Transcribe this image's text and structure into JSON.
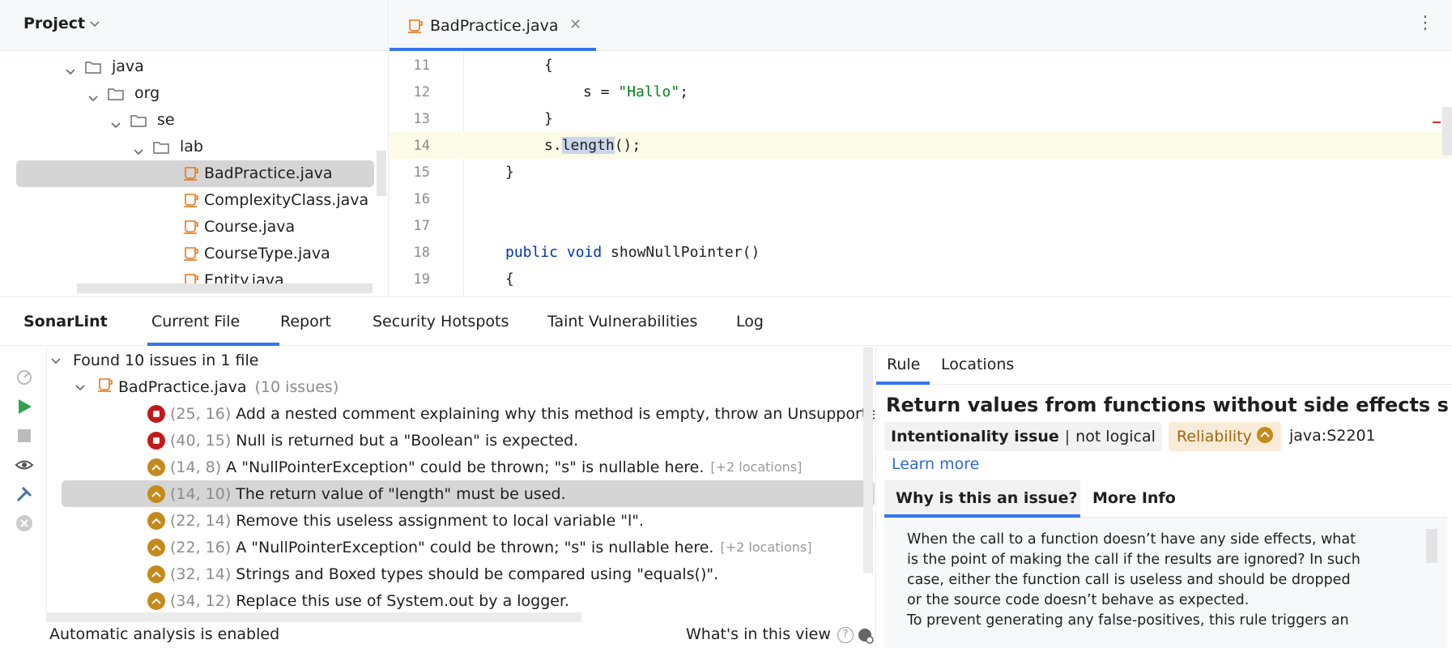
{
  "project": {
    "title": "Project"
  },
  "editor_tab": {
    "name": "BadPractice.java"
  },
  "tree": [
    {
      "label": "java",
      "type": "folder",
      "expanded": true,
      "selected": false
    },
    {
      "label": "org",
      "type": "folder",
      "expanded": true,
      "selected": false
    },
    {
      "label": "se",
      "type": "folder",
      "expanded": true,
      "selected": false
    },
    {
      "label": "lab",
      "type": "folder",
      "expanded": true,
      "selected": false
    },
    {
      "label": "BadPractice.java",
      "type": "java",
      "selected": true
    },
    {
      "label": "ComplexityClass.java",
      "type": "java",
      "selected": false
    },
    {
      "label": "Course.java",
      "type": "java",
      "selected": false
    },
    {
      "label": "CourseType.java",
      "type": "java",
      "selected": false
    },
    {
      "label": "Entity.java",
      "type": "java",
      "selected": false
    }
  ],
  "code_lines": [
    {
      "num": "11",
      "text": "{"
    },
    {
      "num": "12",
      "text": "s = ",
      "str": "\"Hallo\"",
      "after": ";"
    },
    {
      "num": "13",
      "text": "}"
    },
    {
      "num": "14",
      "text": "s.",
      "hl": "length",
      "after": "();"
    },
    {
      "num": "15",
      "text": "}"
    },
    {
      "num": "16",
      "text": ""
    },
    {
      "num": "17",
      "text": ""
    },
    {
      "num": "18",
      "kw": "public void",
      "text": " showNullPointer()"
    },
    {
      "num": "19",
      "text": "{"
    }
  ],
  "sonar": {
    "title": "SonarLint",
    "tabs": [
      "Current File",
      "Report",
      "Security Hotspots",
      "Taint Vulnerabilities",
      "Log"
    ],
    "active_tab": "Current File",
    "summary": "Found 10 issues in 1 file",
    "file": "BadPractice.java",
    "file_count": "(10 issues)",
    "issues": [
      {
        "loc": "(25, 16)",
        "msg": "Add a nested comment explaining why this method is empty, throw an Unsupported",
        "sev": "blocker",
        "extra": ""
      },
      {
        "loc": "(40, 15)",
        "msg": "Null is returned but a \"Boolean\" is expected.",
        "sev": "blocker",
        "extra": ""
      },
      {
        "loc": "(14, 8)",
        "msg": "A \"NullPointerException\" could be thrown; \"s\" is nullable here.",
        "sev": "major",
        "extra": "[+2 locations]"
      },
      {
        "loc": "(14, 10)",
        "msg": "The return value of \"length\" must be used.",
        "sev": "major",
        "extra": "",
        "selected": true
      },
      {
        "loc": "(22, 14)",
        "msg": "Remove this useless assignment to local variable \"l\".",
        "sev": "major",
        "extra": ""
      },
      {
        "loc": "(22, 16)",
        "msg": "A \"NullPointerException\" could be thrown; \"s\" is nullable here.",
        "sev": "major",
        "extra": "[+2 locations]"
      },
      {
        "loc": "(32, 14)",
        "msg": "Strings and Boxed types should be compared using \"equals()\".",
        "sev": "major",
        "extra": ""
      },
      {
        "loc": "(34, 12)",
        "msg": "Replace this use of System.out by a logger.",
        "sev": "major",
        "extra": ""
      }
    ],
    "status": "Automatic analysis is enabled",
    "whats_in_view": "What's in this view"
  },
  "rule": {
    "tabs": [
      "Rule",
      "Locations"
    ],
    "title": "Return values from functions without side effects sh…",
    "type": "Intentionality issue",
    "attr": "not logical",
    "quality": "Reliability",
    "key": "java:S2201",
    "learn_more": "Learn more",
    "subtabs": [
      "Why is this an issue?",
      "More Info"
    ],
    "body": [
      "When the call to a function doesn’t have any side effects, what",
      "is the point of making the call if the results are ignored? In such",
      "case, either the function call is useless and should be dropped",
      "or the source code doesn’t behave as expected.",
      "To prevent generating any false-positives, this rule triggers an"
    ]
  },
  "colors": {
    "accent": "#3574f0",
    "blocker": "#c21a1a",
    "major": "#c48a1b",
    "selection": "#d5d5d5",
    "caret_line": "#fcfbe7",
    "java_icon": "#e5781a"
  }
}
